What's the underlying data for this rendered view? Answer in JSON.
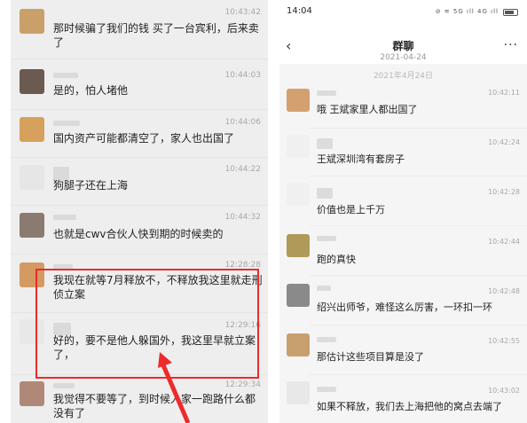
{
  "left_chat": {
    "messages": [
      {
        "time": "10:43:42",
        "text": "那时候骗了我们的钱 买了一台宾利，后来卖了",
        "avatar_color": "#c9a06a"
      },
      {
        "time": "10:44:03",
        "text": "是的，怕人堵他",
        "avatar_color": "#6a5a50"
      },
      {
        "time": "10:44:06",
        "text": "国内资产可能都清空了，家人也出国了",
        "avatar_color": "#d6a15c"
      },
      {
        "time": "10:44:22",
        "text": "狗腿子还在上海",
        "avatar_color": "#e6e6e6"
      },
      {
        "time": "10:44:32",
        "text": "也就是cwv合伙人快到期的时候卖的",
        "avatar_color": "#8a7a70"
      },
      {
        "time": "12:28:28",
        "text": "我现在就等7月释放不，不释放我这里就走刑侦立案",
        "avatar_color": "#d49a64"
      },
      {
        "time": "12:29:16",
        "text": "好的，要不是他人躲国外，我这里早就立案了，",
        "avatar_color": "#e8e8e8"
      },
      {
        "time": "12:29:34",
        "text": "我觉得不要等了，到时候人家一跑路什么都没有了",
        "avatar_color": "#b08878"
      }
    ]
  },
  "right_chat": {
    "status_time": "14:04",
    "status_icons": "⊘ ≋ 5G ıll 4G ıll",
    "back_icon": "‹",
    "title": "群聊",
    "subtitle": "2021-04-24",
    "more_icon": "···",
    "date_divider": "2021年4月24日",
    "messages": [
      {
        "time": "10:42:11",
        "text": "哦 王斌家里人都出国了",
        "avatar_color": "#d4a070"
      },
      {
        "time": "10:42:24",
        "text": "王斌深圳湾有套房子",
        "avatar_color": "#f0f0f0"
      },
      {
        "time": "10:42:28",
        "text": "价值也是上千万",
        "avatar_color": "#f0f0f0"
      },
      {
        "time": "10:42:44",
        "text": "跑的真快",
        "avatar_color": "#b09a5a"
      },
      {
        "time": "10:42:48",
        "text": "绍兴出师爷，难怪这么厉害，一环扣一环",
        "avatar_color": "#8a8a8a"
      },
      {
        "time": "10:42:55",
        "text": "那估计这些项目算是没了",
        "avatar_color": "#c8a070"
      },
      {
        "time": "10:43:02",
        "text": "如果不释放，我们去上海把他的窝点去端了",
        "avatar_color": "#e8e8e8"
      }
    ]
  },
  "colors": {
    "highlight_box": "#ee2a2a",
    "arrow": "#ee2a2a"
  }
}
